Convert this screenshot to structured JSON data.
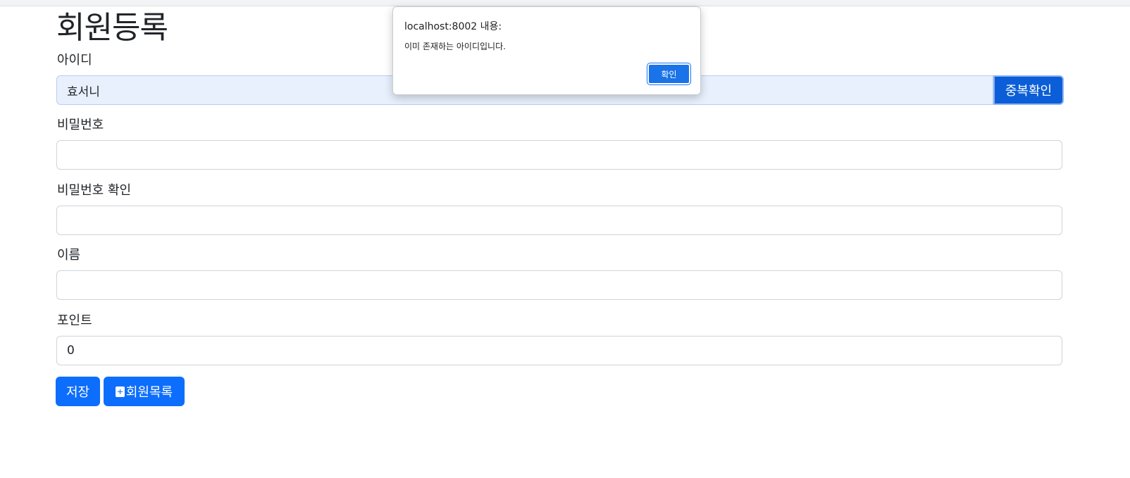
{
  "form": {
    "title": "회원등록",
    "id_field": {
      "label": "아이디",
      "value": "효서니",
      "check_button": "중복확인"
    },
    "password_field": {
      "label": "비밀번호",
      "value": ""
    },
    "password_confirm_field": {
      "label": "비밀번호 확인",
      "value": ""
    },
    "name_field": {
      "label": "이름",
      "value": ""
    },
    "point_field": {
      "label": "포인트",
      "value": "0"
    },
    "buttons": {
      "save": "저장",
      "member_list": "회원목록",
      "member_list_icon": "plus-square-icon"
    }
  },
  "alert": {
    "origin": "localhost:8002 내용:",
    "message": "이미 존재하는 아이디입니다.",
    "ok_button": "확인"
  },
  "colors": {
    "primary": "#0d6efd",
    "dialog_button": "#1a73e8",
    "autofill_background": "#e8f0fe"
  }
}
